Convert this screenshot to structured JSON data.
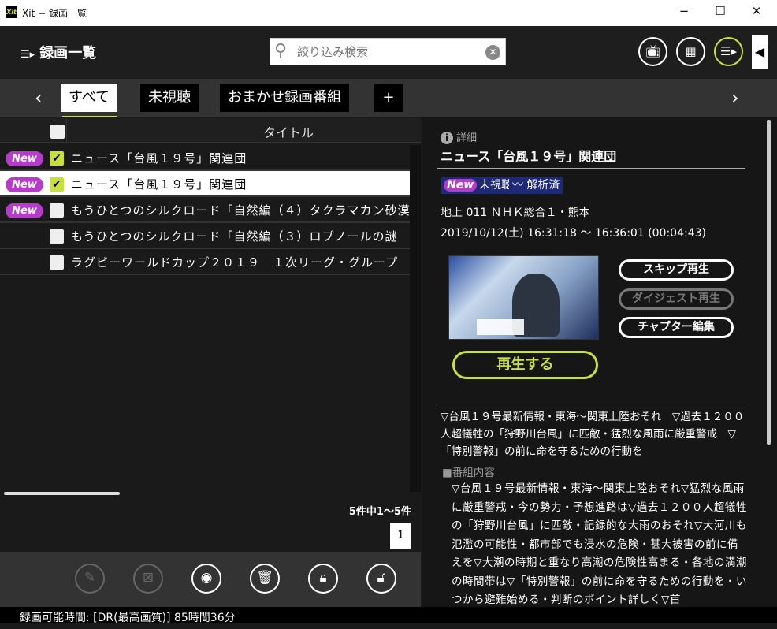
{
  "window": {
    "logo": "Xit",
    "title": "Xit − 録画一覧",
    "minimize": "−",
    "maximize": "☐",
    "close": "✕"
  },
  "header": {
    "title": "録画一覧",
    "search_placeholder": "絞り込み検索",
    "search_value": ""
  },
  "tabs": [
    {
      "label": "すべて",
      "active": true
    },
    {
      "label": "未視聴"
    },
    {
      "label": "おまかせ録画番組"
    },
    {
      "label": "+"
    }
  ],
  "list": {
    "column_title": "タイトル",
    "rows": [
      {
        "new": "New",
        "checked": true,
        "title": "ニュース「台風１９号」関連団",
        "selected": false
      },
      {
        "new": "New",
        "checked": true,
        "title": "ニュース「台風１９号」関連団",
        "selected": true
      },
      {
        "new": "New",
        "checked": false,
        "title": "もうひとつのシルクロード「自然編（４）タクラマカン砂漠",
        "selected": false
      },
      {
        "new": "",
        "checked": false,
        "title": "もうひとつのシルクロード「自然編（３）ロプノールの謎",
        "selected": false
      },
      {
        "new": "",
        "checked": false,
        "title": "ラグビーワールドカップ２０１９　１次リーグ・グループ",
        "selected": false
      }
    ],
    "count": "5件中1〜5件",
    "page": "1"
  },
  "status": "録画可能時間: [DR(最高画質)] 85時間36分",
  "detail": {
    "section": "詳細",
    "title": "ニュース「台風１９号」関連団",
    "badge_new": "New",
    "badge_unwatched": "未視聴",
    "badge_analyzed": "解析済",
    "channel": "地上 011 ＮＨＫ総合１・熊本",
    "time": "2019/10/12(土) 16:31:18 〜 16:36:01 (00:04:43)",
    "skip_play": "スキップ再生",
    "digest_play": "ダイジェスト再生",
    "chapter_edit": "チャプター編集",
    "play": "再生する",
    "summary": "▽台風１９号最新情報・東海〜関東上陸おそれ　▽過去１２００人超犠牲の「狩野川台風」に匹敵・猛烈な風雨に厳重警戒　▽「特別警報」の前に命を守るための行動を",
    "content_label": "■番組内容",
    "content": "▽台風１９号最新情報・東海〜関東上陸おそれ▽猛烈な風雨に厳重警戒・今の勢力・予想進路は▽過去１２００人超犠牲の「狩野川台風」に匹敵・記録的な大雨のおそれ▽大河川も氾濫の可能性・都市部でも浸水の危険・甚大被害の前に備えを▽大潮の時期と重なり高潮の危険性高まる・各地の満潮の時間帯は▽「特別警報」の前に命を守るための行動を・いつから避難始める・判断のポイント詳しく▽首"
  },
  "colors": {
    "accent": "#c8e03c",
    "new_badge": "#b43cc8",
    "analyzed_bg": "#1e2a78"
  }
}
